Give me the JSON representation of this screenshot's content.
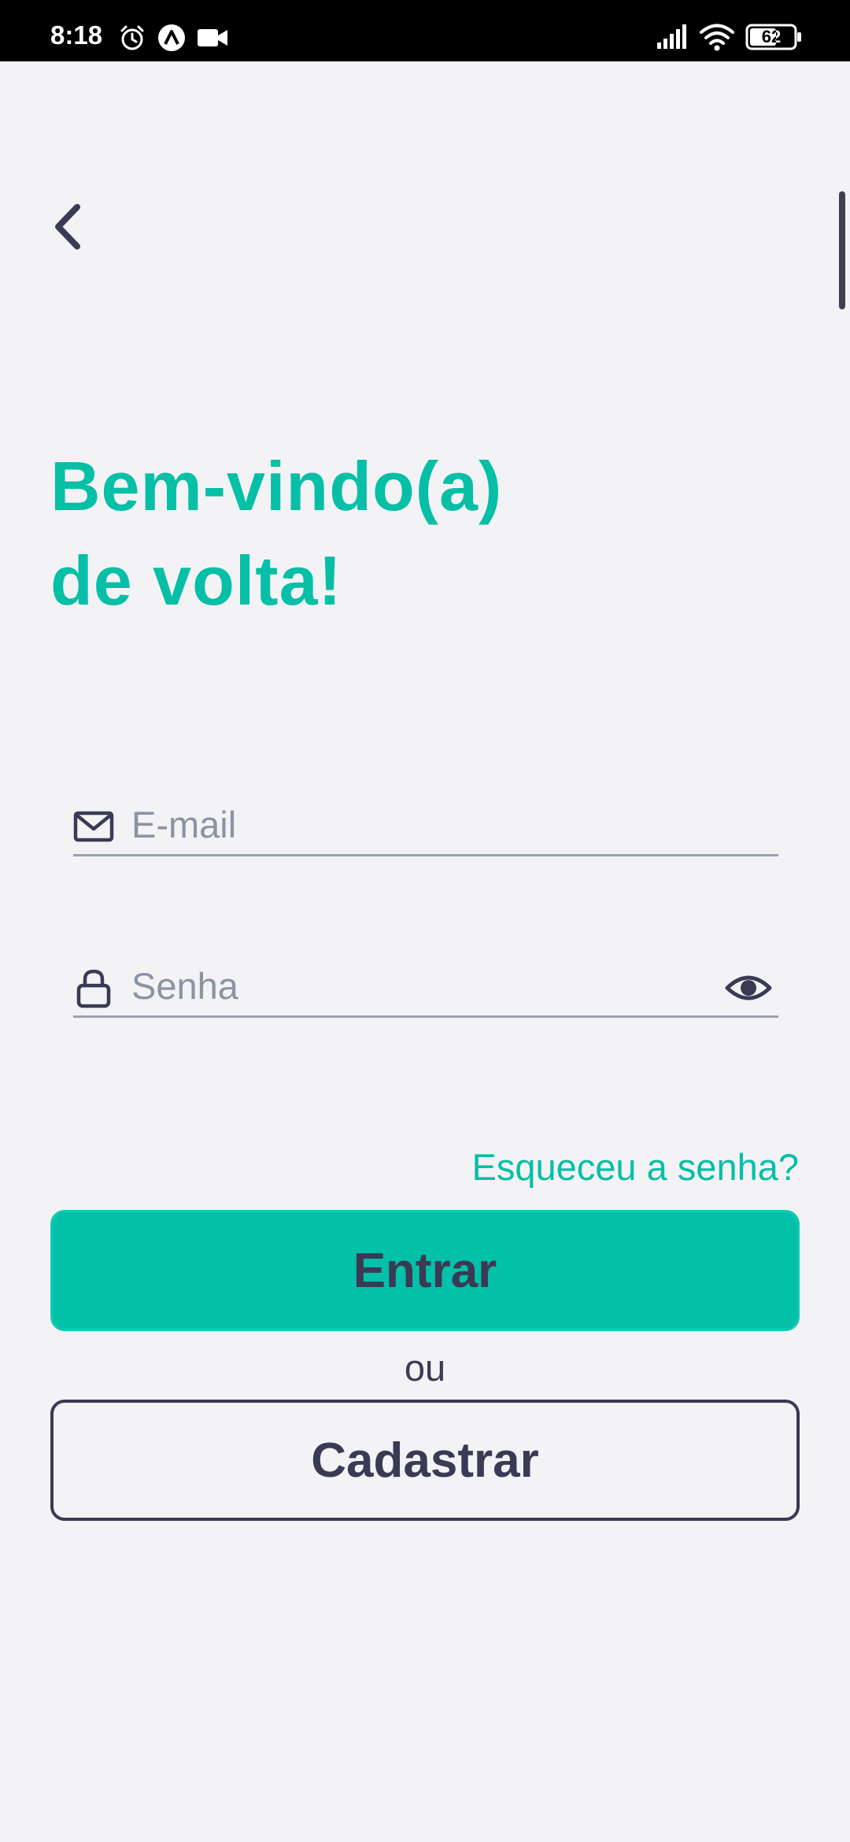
{
  "status_bar": {
    "time": "8:18",
    "icons": [
      "alarm-icon",
      "app-notification-icon",
      "video-camera-icon",
      "signal-icon",
      "wifi-icon",
      "battery-icon"
    ],
    "battery": "62"
  },
  "header": {
    "back_icon": "chevron-left-icon"
  },
  "title": {
    "line1": "Bem-vindo(a)",
    "line2": "de volta!"
  },
  "form": {
    "email": {
      "icon": "envelope-icon",
      "value": "",
      "placeholder": "E-mail"
    },
    "password": {
      "icon": "lock-icon",
      "value": "",
      "placeholder": "Senha",
      "toggle_icon": "eye-icon"
    },
    "forgot_label": "Esqueceu a senha?",
    "login_label": "Entrar",
    "or_label": "ou",
    "register_label": "Cadastrar"
  },
  "colors": {
    "accent": "#06bfa6",
    "button_fill": "#03c0a8",
    "text_dark": "#3a3a55",
    "background": "#f3f3f6"
  }
}
